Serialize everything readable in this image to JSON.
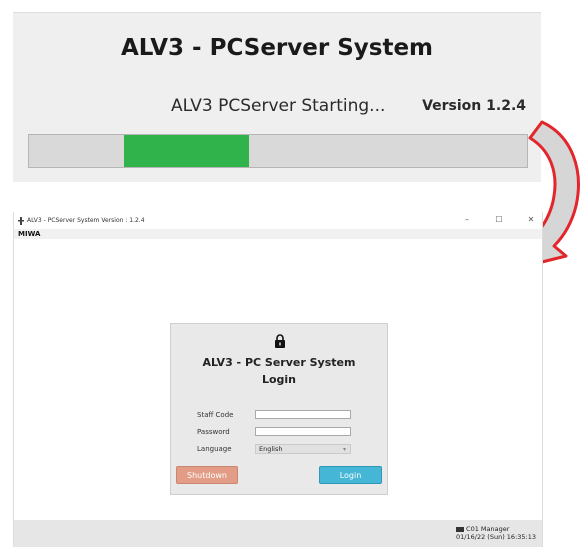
{
  "splash": {
    "title": "ALV3 - PCServer System",
    "status": "ALV3 PCServer Starting...",
    "version": "Version 1.2.4",
    "progress": 0.25
  },
  "window": {
    "title": "ALV3 - PCServer System Version : 1.2.4",
    "controls": {
      "minimize": "–",
      "maximize": "☐",
      "close": "✕"
    },
    "menu": [
      "MIWA"
    ]
  },
  "login": {
    "title_line1": "ALV3 - PC Server System",
    "title_line2": "Login",
    "staff_code_label": "Staff Code",
    "staff_code_value": "",
    "password_label": "Password",
    "password_value": "",
    "language_label": "Language",
    "language_value": "English",
    "shutdown_label": "Shutdown",
    "login_label": "Login"
  },
  "statusbar": {
    "user": "C01 Manager",
    "datetime": "01/16/22 (Sun) 16:35:13"
  },
  "colors": {
    "progress": "#2fb34a",
    "arrow_fill": "#d6d6d6",
    "arrow_stroke": "#e2262b",
    "shutdown": "#e39c85",
    "login": "#46b6d6"
  },
  "icons": [
    "lock-icon",
    "app-icon",
    "user-icon",
    "curved-arrow-icon"
  ]
}
